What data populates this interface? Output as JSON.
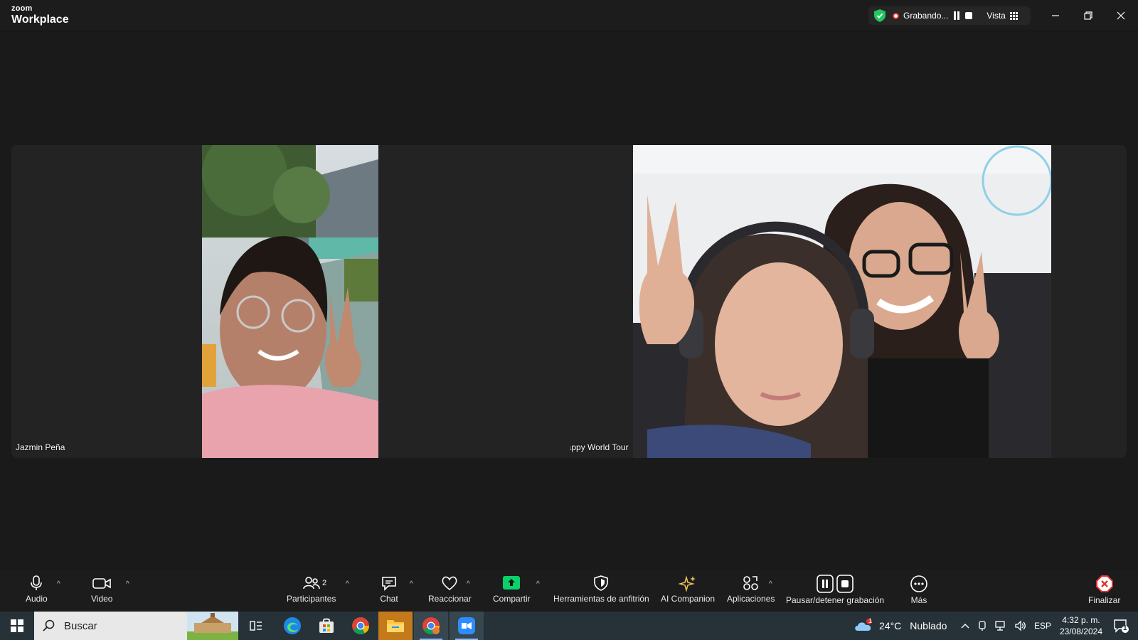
{
  "window": {
    "brand_small": "zoom",
    "brand_big": "Workplace",
    "recording_status": "Grabando...",
    "view_label": "Vista"
  },
  "participants": [
    {
      "name": "Jazmin Peña"
    },
    {
      "name": "Happy World Tour"
    }
  ],
  "toolbar": {
    "audio": "Audio",
    "video": "Video",
    "participants": "Participantes",
    "participants_count": "2",
    "chat": "Chat",
    "react": "Reaccionar",
    "share": "Compartir",
    "host_tools": "Herramientas de anfitrión",
    "ai_companion": "AI Companion",
    "apps": "Aplicaciones",
    "pause_stop_recording": "Pausar/detener grabación",
    "more": "Más",
    "end": "Finalizar"
  },
  "taskbar": {
    "search_placeholder": "Buscar",
    "weather_temp": "24°C",
    "weather_desc": "Nublado",
    "weather_badge": "1",
    "language": "ESP",
    "time": "4:32 p. m.",
    "date": "23/08/2024",
    "notification_count": "1"
  },
  "colors": {
    "share_green": "#0bd16b",
    "end_red": "#e0322c",
    "ai_gold": "#e8c25a",
    "shield_green": "#22c55e",
    "zoom_blue": "#2d8cff"
  }
}
